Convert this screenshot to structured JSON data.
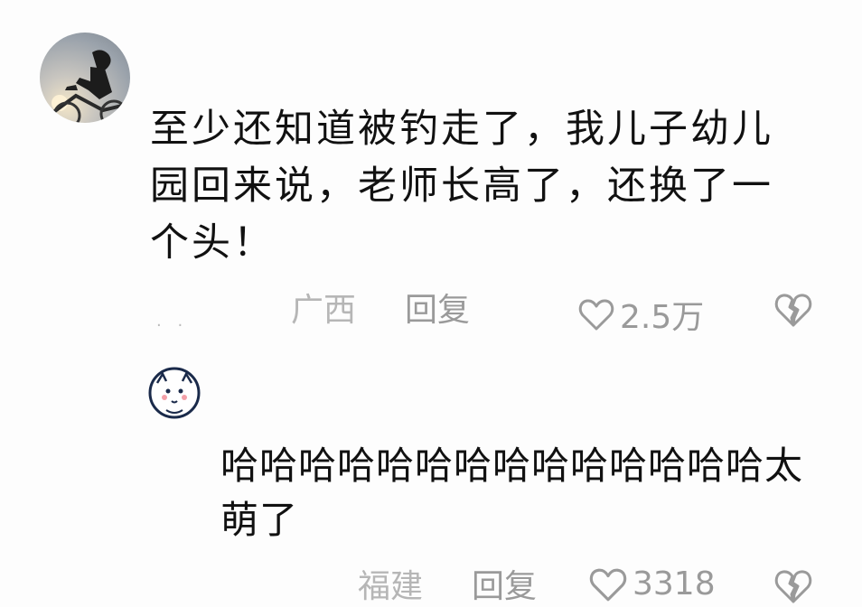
{
  "comments": [
    {
      "text": "至少还知道被钓走了，我儿子幼儿园回来说，老师长高了，还换了一个头！",
      "dots": "· ·",
      "location": "广西",
      "reply_label": "回复",
      "likes": "2.5万"
    },
    {
      "text": "哈哈哈哈哈哈哈哈哈哈哈哈哈哈太萌了",
      "location": "福建",
      "reply_label": "回复",
      "likes": "3318"
    }
  ],
  "colors": {
    "text": "#111111",
    "meta": "#9a9a9a",
    "background": "#fdfdfd"
  },
  "icons": {
    "like": "heart-outline-icon",
    "dislike": "broken-heart-icon"
  }
}
